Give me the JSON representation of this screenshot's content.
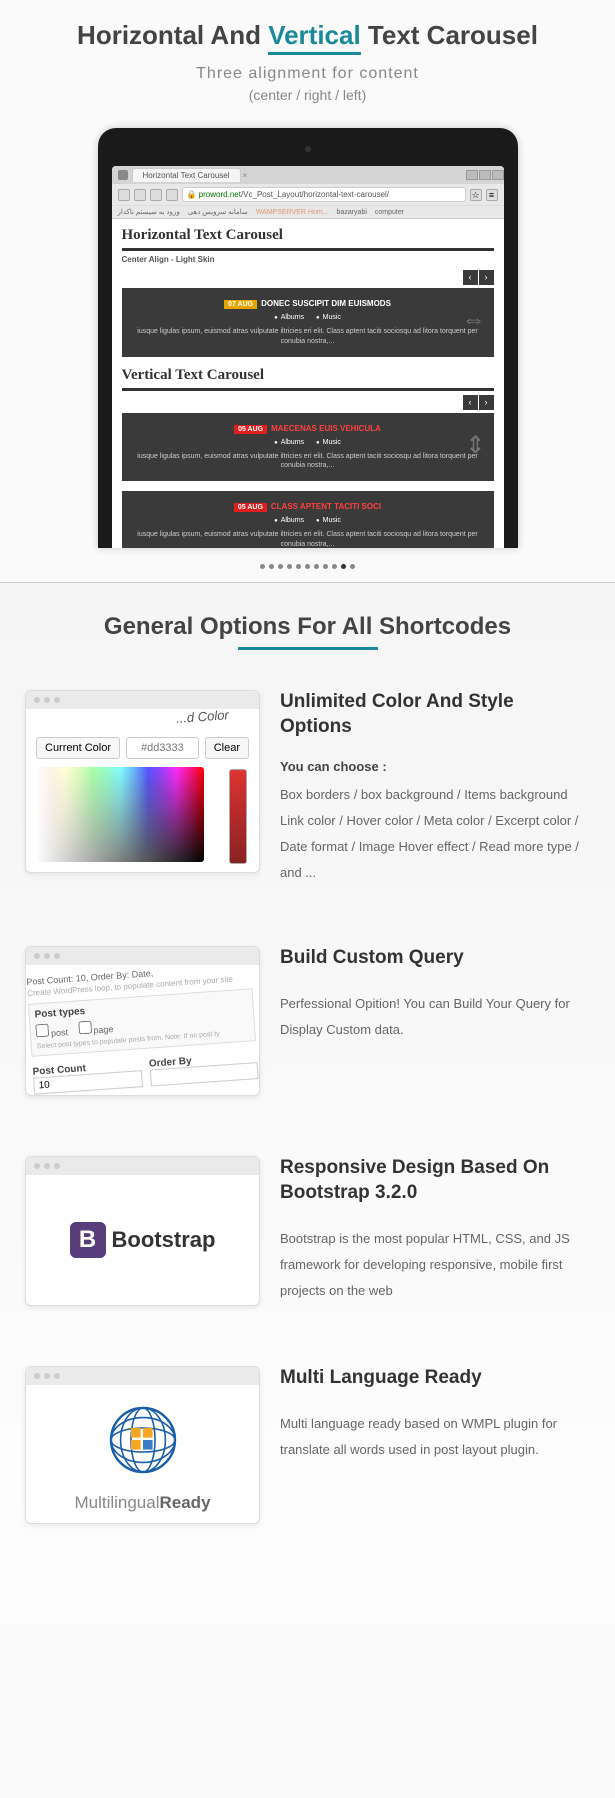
{
  "section1": {
    "title_before": "Horizontal And ",
    "title_highlight": "Vertical",
    "title_after": " Text Carousel",
    "subtitle": "Three alignment for content",
    "subtitle2": "(center / right / left)"
  },
  "browser": {
    "tab": "Horizontal Text Carousel",
    "url_prefix": "proword.net",
    "url_path": "/Vc_Post_Layout/horizontal-text-carousel/",
    "bookmarks": [
      "ورود به سیستم ناکدار",
      "سامانه سرویس دهی",
      "WAMPSERVER Hom...",
      "bazaryabi",
      "computer"
    ],
    "h1": "Horizontal Text Carousel",
    "sub1": "Center Align - Light Skin",
    "card1": {
      "date": "07 AUG",
      "title": "DONEC SUSCIPIT DIM EUISMODS",
      "cats": [
        "Albums",
        "Music"
      ],
      "text": "iusque ligulas ipsum, euismod atras vulputate iltricies eri elit. Class aptent taciti sociosqu ad litora torquent per conubia nostra,..."
    },
    "h2": "Vertical Text Carousel",
    "card2": {
      "date": "05 AUG",
      "title": "MAECENAS EUIS VEHICULA",
      "cats": [
        "Albums",
        "Music"
      ],
      "text": "iusque ligulas ipsum, euismod atras vulputate iltricies eri elit. Class aptent taciti sociosqu ad litora torquent per conubia nostra,..."
    },
    "card3": {
      "date": "05 AUG",
      "title": "CLASS APTENT TACITI SOCI",
      "cats": [
        "Albums",
        "Music"
      ],
      "text": "iusque ligulas ipsum, euismod atras vulputate iltricies eri elit. Class aptent taciti sociosqu ad litora torquent per conubia nostra,..."
    }
  },
  "section2": {
    "title": "General Options For All Shortcodes"
  },
  "feature1": {
    "title": "Unlimited Color And Style Options",
    "lead": "You can choose :",
    "desc": "Box borders / box background / Items background Link color /   Hover color / Meta color /   Excerpt color /  Date format / Image Hover effect / Read more type / and ...",
    "thumb": {
      "label": "...d Color",
      "current": "Current Color",
      "hex": "#dd3333",
      "clear": "Clear"
    }
  },
  "feature2": {
    "title": "Build Custom Query",
    "desc": "Perfessional Opition! You can Build Your Query for Display Custom data.",
    "thumb": {
      "summary": "Post Count: 10, Order By: Date,",
      "hint": "Create WordPress loop, to populate content from your site",
      "posttypes_label": "Post types",
      "opt_post": "post",
      "opt_page": "page",
      "hint2": "Select post types to populate posts from. Note: If no post ty",
      "postcount_label": "Post Count",
      "postcount_value": "10",
      "orderby_label": "Order By"
    }
  },
  "feature3": {
    "title": "Responsive Design Based On Bootstrap 3.2.0",
    "desc": "Bootstrap is the most popular HTML, CSS, and JS framework for developing responsive, mobile first projects on the web",
    "thumb": {
      "logo_b": "B",
      "logo_text": "Bootstrap"
    }
  },
  "feature4": {
    "title": "Multi Language Ready",
    "desc": "Multi language ready based on WMPL plugin for translate all words used in post layout plugin.",
    "thumb": {
      "text_a": "Multilingual",
      "text_b": "Ready"
    }
  }
}
